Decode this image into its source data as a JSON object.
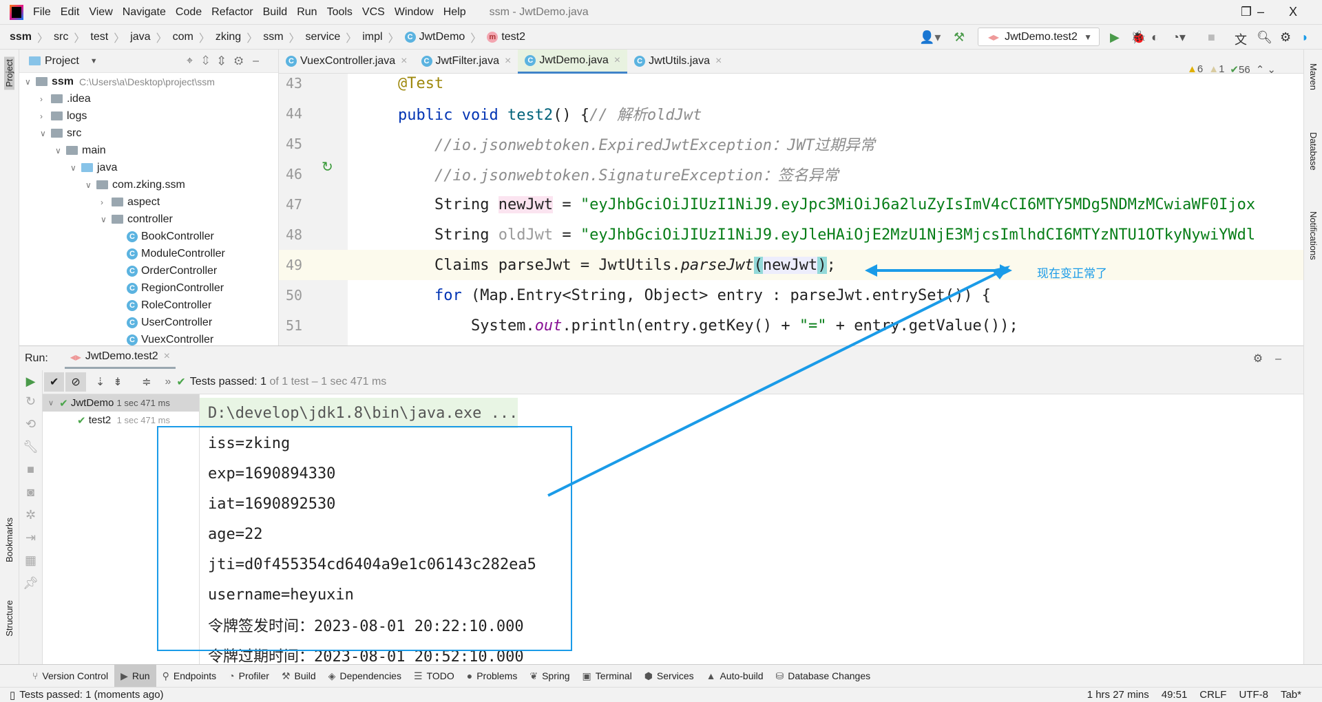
{
  "window": {
    "title": "ssm - JwtDemo.java",
    "minimize": "–",
    "restore": "❐",
    "close": "X"
  },
  "menu": [
    "File",
    "Edit",
    "View",
    "Navigate",
    "Code",
    "Refactor",
    "Build",
    "Run",
    "Tools",
    "VCS",
    "Window",
    "Help"
  ],
  "breadcrumb": [
    "ssm",
    "src",
    "test",
    "java",
    "com",
    "zking",
    "ssm",
    "service",
    "impl",
    "JwtDemo",
    "test2"
  ],
  "run_config": "JwtDemo.test2",
  "project": {
    "title": "Project",
    "tree": [
      {
        "label": "ssm",
        "path": "C:\\Users\\a\\Desktop\\project\\ssm",
        "depth": 0,
        "type": "folder",
        "expanded": true
      },
      {
        "label": ".idea",
        "depth": 1,
        "type": "folder",
        "expanded": false
      },
      {
        "label": "logs",
        "depth": 1,
        "type": "folder",
        "expanded": false
      },
      {
        "label": "src",
        "depth": 1,
        "type": "folder",
        "expanded": true
      },
      {
        "label": "main",
        "depth": 2,
        "type": "folder",
        "expanded": true
      },
      {
        "label": "java",
        "depth": 3,
        "type": "folder-blue",
        "expanded": true
      },
      {
        "label": "com.zking.ssm",
        "depth": 4,
        "type": "package",
        "expanded": true
      },
      {
        "label": "aspect",
        "depth": 5,
        "type": "package",
        "expanded": false
      },
      {
        "label": "controller",
        "depth": 5,
        "type": "package",
        "expanded": true
      },
      {
        "label": "BookController",
        "depth": 6,
        "type": "class"
      },
      {
        "label": "ModuleController",
        "depth": 6,
        "type": "class"
      },
      {
        "label": "OrderController",
        "depth": 6,
        "type": "class"
      },
      {
        "label": "RegionController",
        "depth": 6,
        "type": "class"
      },
      {
        "label": "RoleController",
        "depth": 6,
        "type": "class"
      },
      {
        "label": "UserController",
        "depth": 6,
        "type": "class"
      },
      {
        "label": "VuexController",
        "depth": 6,
        "type": "class"
      }
    ]
  },
  "editor": {
    "tabs": [
      {
        "label": "VuexController.java",
        "active": false
      },
      {
        "label": "JwtFilter.java",
        "active": false
      },
      {
        "label": "JwtDemo.java",
        "active": true
      },
      {
        "label": "JwtUtils.java",
        "active": false
      }
    ],
    "inspections": {
      "warnings": "6",
      "weak_warnings": "1",
      "typos": "56"
    },
    "lines": [
      {
        "n": "43",
        "html": "    <span class='ann'>@Test</span>"
      },
      {
        "n": "44",
        "html": "    <span class='kw'>public void</span> <span class='fn'>test2</span>() {<span class='cm'>// 解析oldJwt</span>"
      },
      {
        "n": "45",
        "html": "        <span class='cm'>//io.jsonwebtoken.ExpiredJwtException：JWT过期异常</span>"
      },
      {
        "n": "46",
        "html": "        <span class='cm'>//io.jsonwebtoken.SignatureException：签名异常</span>"
      },
      {
        "n": "47",
        "html": "        String <span style='background:#fbe4f0'>newJwt</span> = <span class='str'>\"eyJhbGciOiJIUzI1NiJ9.eyJpc3MiOiJ6a2luZyIsImV4cCI6MTY5MDg5NDMzMCwiaWF0Ijox</span>"
      },
      {
        "n": "48",
        "html": "        String <span class='mut'>oldJwt</span> = <span class='str'>\"eyJhbGciOiJIUzI1NiJ9.eyJleHAiOjE2MzU1NjE3MjcsImlhdCI6MTYzNTU1OTkyNywiYWdl</span>"
      },
      {
        "n": "49",
        "html": "        Claims parseJwt = JwtUtils.<i>parseJwt</i><span style='background:#93d9d9'>(</span><span style='background:#ededfc'>newJwt</span><span style='background:#93d9d9'>)</span>;"
      },
      {
        "n": "50",
        "html": "        <span class='kw'>for</span> (Map.Entry&lt;String, Object&gt; entry : parseJwt.entrySet()) {"
      },
      {
        "n": "51",
        "html": "            System.<span class='gr'>out</span>.println(entry.getKey() + <span class='str'>\"=\"</span> + entry.getValue());"
      }
    ]
  },
  "annotation": {
    "note": "现在变正常了",
    "color": "#1a9be8"
  },
  "right_tools": [
    "Maven",
    "Database",
    "Notifications"
  ],
  "left_tools": [
    "Project",
    "Bookmarks",
    "Structure"
  ],
  "run": {
    "label": "Run:",
    "tab": "JwtDemo.test2",
    "status": {
      "bold": "Tests passed:",
      "count": "1",
      "rest": "of 1 test – 1 sec 471 ms"
    },
    "tree": [
      {
        "label": "JwtDemo",
        "time": "1 sec 471 ms"
      },
      {
        "label": "test2",
        "time": "1 sec 471 ms"
      }
    ],
    "console": [
      "D:\\develop\\jdk1.8\\bin\\java.exe ...",
      "iss=zking",
      "exp=1690894330",
      "iat=1690892530",
      "age=22",
      "jti=d0f455354cd6404a9e1c06143c282ea5",
      "username=heyuxin",
      "令牌签发时间：2023-08-01 20:22:10.000",
      "令牌过期时间：2023-08-01 20:52:10.000"
    ]
  },
  "bottom_tools": [
    {
      "label": "Version Control",
      "active": false
    },
    {
      "label": "Run",
      "active": true
    },
    {
      "label": "Endpoints"
    },
    {
      "label": "Profiler"
    },
    {
      "label": "Build"
    },
    {
      "label": "Dependencies"
    },
    {
      "label": "TODO"
    },
    {
      "label": "Problems"
    },
    {
      "label": "Spring"
    },
    {
      "label": "Terminal"
    },
    {
      "label": "Services"
    },
    {
      "label": "Auto-build"
    },
    {
      "label": "Database Changes"
    }
  ],
  "status_bar": {
    "message": "Tests passed: 1 (moments ago)",
    "time": "1 hrs 27 mins",
    "position": "49:51",
    "line_sep": "CRLF",
    "encoding": "UTF-8",
    "indent": "Tab*"
  }
}
